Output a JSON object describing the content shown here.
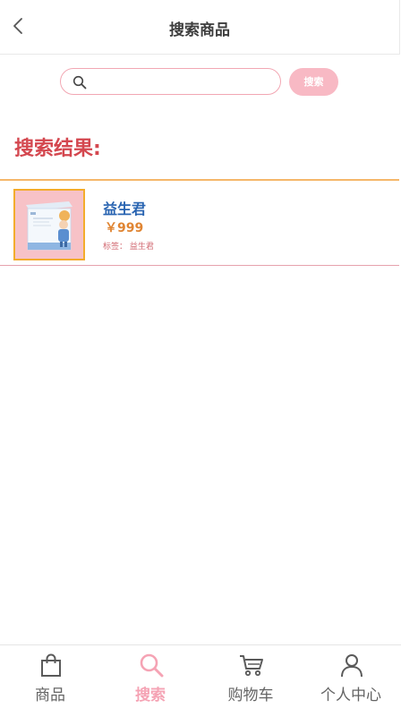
{
  "header": {
    "title": "搜索商品"
  },
  "search": {
    "placeholder": "",
    "value": "",
    "button_label": "搜索"
  },
  "results": {
    "heading": "搜索结果:",
    "items": [
      {
        "name": "益生君",
        "price": "￥999",
        "tag_line": "标签：  益生君"
      }
    ]
  },
  "tabbar": {
    "tabs": [
      {
        "label": "商品",
        "icon": "shopping-bag-icon",
        "active": false
      },
      {
        "label": "搜索",
        "icon": "search-icon",
        "active": true
      },
      {
        "label": "购物车",
        "icon": "cart-icon",
        "active": false
      },
      {
        "label": "个人中心",
        "icon": "person-icon",
        "active": false
      }
    ]
  },
  "colors": {
    "accent_pink": "#f8b9c4",
    "results_title": "#d4474f",
    "product_name": "#2964b1",
    "price": "#e08533",
    "thumb_border": "#f3ac2c"
  }
}
